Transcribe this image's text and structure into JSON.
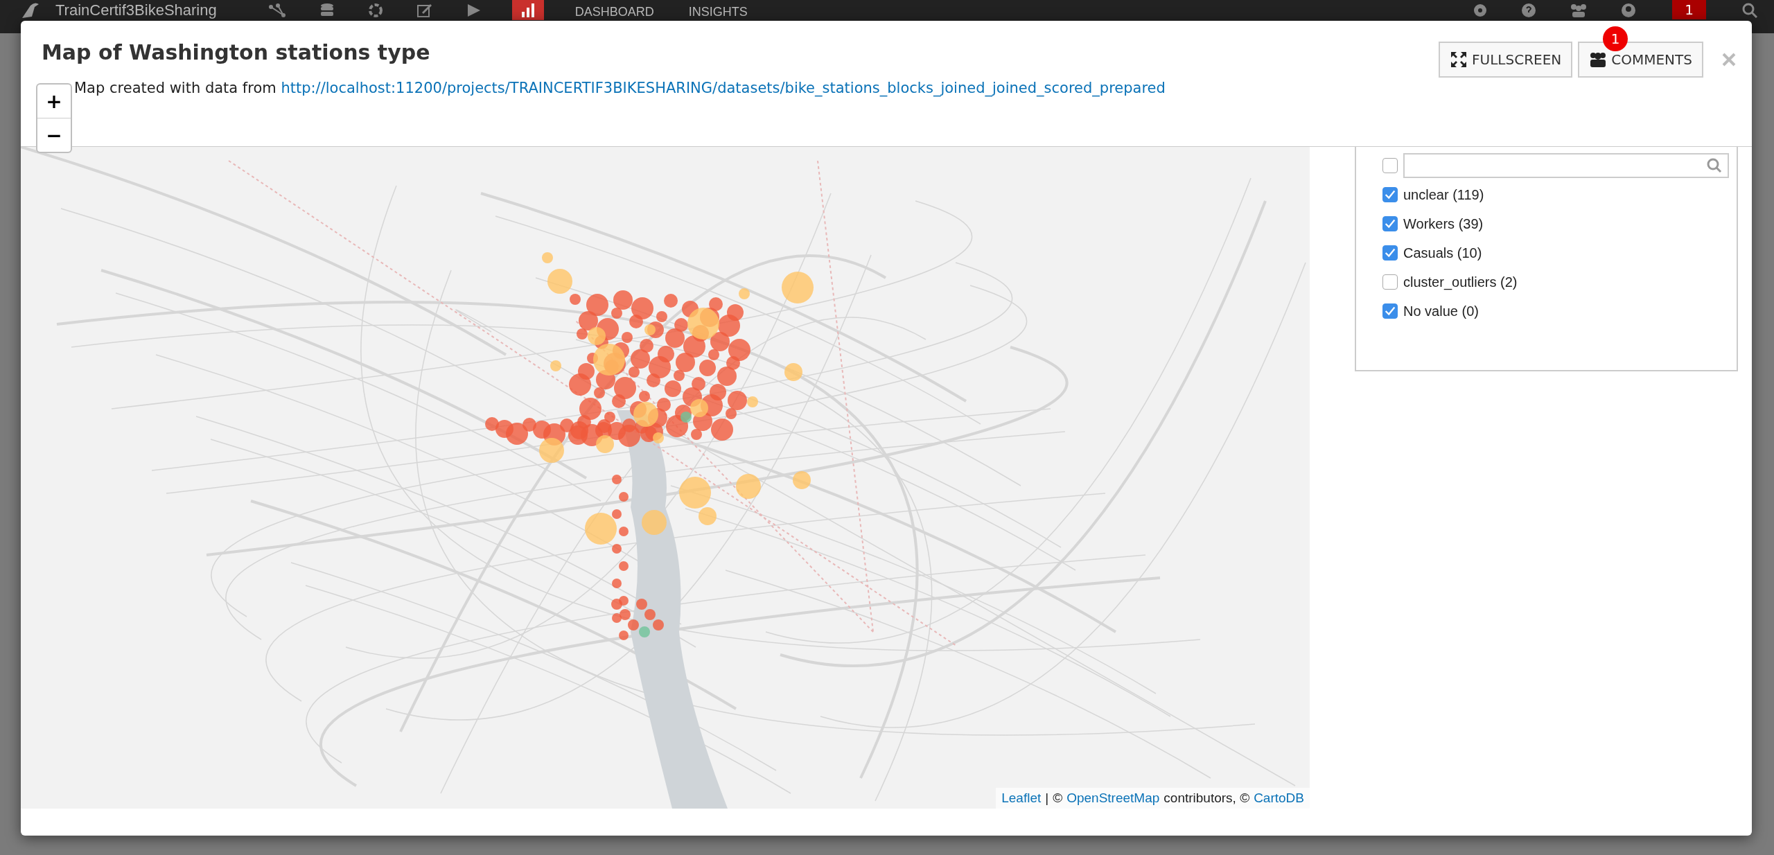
{
  "topbar": {
    "project": "TrainCertif3BikeSharing",
    "nav": [
      {
        "label": "DASHBOARD"
      },
      {
        "label": "INSIGHTS"
      }
    ],
    "notifications": "1"
  },
  "modal": {
    "title": "Map of Washington stations type",
    "buttons": [
      {
        "label": "FULLSCREEN",
        "kind": "fullscreen"
      },
      {
        "label": "COMMENTS",
        "kind": "comments",
        "badge": "1"
      }
    ],
    "description": "Map created with data from",
    "link": "http://localhost:11200/projects/TRAINCERTIF3BIKESHARING/datasets/bike_stations_blocks_joined_joined_scored_prepared",
    "zoom": [
      "+",
      "−"
    ],
    "attribution": [
      {
        "text": "Leaflet",
        "kind": "link"
      },
      {
        "text": "|",
        "kind": "text"
      },
      {
        "text": "©",
        "kind": "text"
      },
      {
        "text": "OpenStreetMap",
        "kind": "link"
      },
      {
        "text": "contributors, ©",
        "kind": "text"
      },
      {
        "text": "CartoDB",
        "kind": "link"
      }
    ],
    "legend": {
      "select_all": false,
      "items": [
        {
          "label": "unclear (119)",
          "checked": true
        },
        {
          "label": "Workers (39)",
          "checked": true
        },
        {
          "label": "Casuals (10)",
          "checked": true
        },
        {
          "label": "cluster_outliers (2)",
          "checked": false
        },
        {
          "label": "No value (0)",
          "checked": true
        }
      ]
    }
  }
}
